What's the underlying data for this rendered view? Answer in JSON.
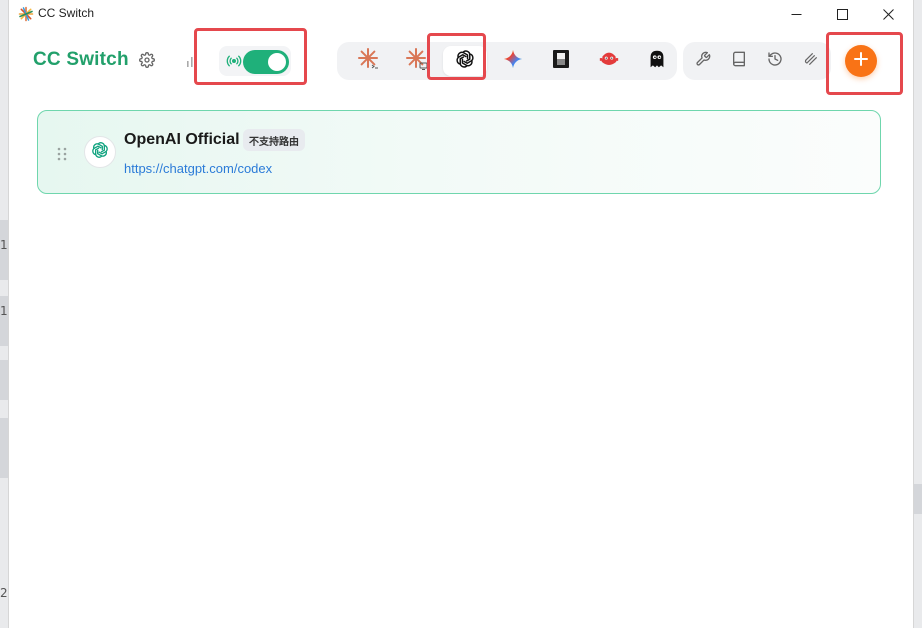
{
  "window": {
    "title": "CC Switch"
  },
  "header": {
    "brand": "CC Switch"
  },
  "icons": {
    "app": "sunburst-logo-icon",
    "settings": "gear-icon",
    "stats": "bar-chart-icon",
    "broadcast": "broadcast-icon",
    "tools": [
      "wrench-icon",
      "book-icon",
      "history-icon",
      "skills-icon"
    ],
    "add": "plus-icon"
  },
  "app_tabs": [
    {
      "name": "claude-code",
      "icon": "claude-terminal-icon",
      "active": false
    },
    {
      "name": "claude-desktop",
      "icon": "claude-desktop-icon",
      "active": false
    },
    {
      "name": "codex",
      "icon": "openai-icon",
      "active": true
    },
    {
      "name": "gemini",
      "icon": "gemini-sparkle-icon",
      "active": false
    },
    {
      "name": "opencode",
      "icon": "square-block-icon",
      "active": false
    },
    {
      "name": "red-bot",
      "icon": "red-robot-icon",
      "active": false
    },
    {
      "name": "ghost",
      "icon": "ghost-icon",
      "active": false
    }
  ],
  "proxy": {
    "enabled": true
  },
  "colors": {
    "brand": "#22a06b",
    "toggle_on": "#1fb07a",
    "add_button": "#f97316",
    "highlight": "#e5484d",
    "link": "#2b7bd8"
  },
  "provider": {
    "name": "OpenAI Official",
    "badge": "不支持路由",
    "url": "https://chatgpt.com/codex"
  }
}
